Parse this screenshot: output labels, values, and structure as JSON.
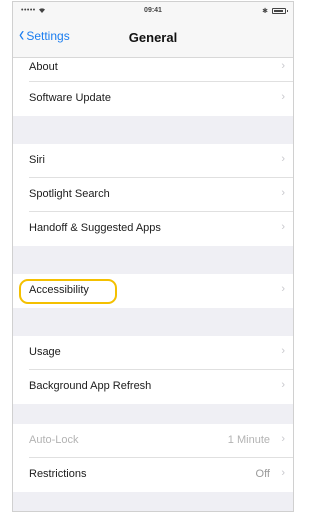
{
  "status_bar": {
    "signal": "•••••",
    "wifi_icon": "wifi-icon",
    "time": "09:41",
    "bluetooth": "✱",
    "battery_icon": "battery-icon"
  },
  "nav": {
    "back_label": "Settings",
    "back_icon": "chevron-left-icon",
    "title": "General"
  },
  "rows": {
    "about": {
      "label": "About",
      "chevron": "›"
    },
    "software_update": {
      "label": "Software Update",
      "chevron": "›"
    },
    "siri": {
      "label": "Siri",
      "chevron": "›"
    },
    "spotlight_search": {
      "label": "Spotlight Search",
      "chevron": "›"
    },
    "handoff": {
      "label": "Handoff & Suggested Apps",
      "chevron": "›"
    },
    "accessibility": {
      "label": "Accessibility",
      "chevron": "›"
    },
    "usage": {
      "label": "Usage",
      "chevron": "›"
    },
    "background_refresh": {
      "label": "Background App Refresh",
      "chevron": "›"
    },
    "auto_lock": {
      "label": "Auto-Lock",
      "value": "1 Minute",
      "chevron": "›"
    },
    "restrictions": {
      "label": "Restrictions",
      "value": "Off",
      "chevron": "›"
    }
  },
  "colors": {
    "accent": "#1a7df0",
    "highlight": "#f4c000",
    "group_background": "#efeff4"
  }
}
